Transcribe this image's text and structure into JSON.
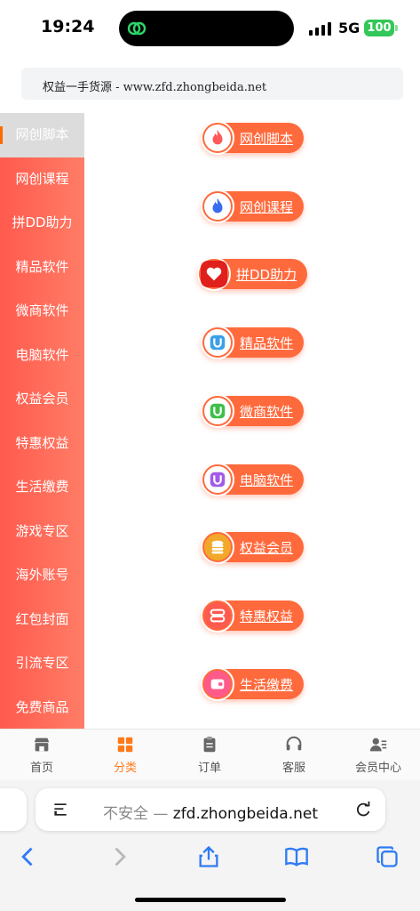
{
  "status": {
    "time": "19:24",
    "network": "5G",
    "battery": "100"
  },
  "notice": {
    "text": "权益一手货源 - www.zfd.zhongbeida.net"
  },
  "sidebar": {
    "items": [
      {
        "label": "网创脚本",
        "active": true
      },
      {
        "label": "网创课程"
      },
      {
        "label": "拼DD助力"
      },
      {
        "label": "精品软件"
      },
      {
        "label": "微商软件"
      },
      {
        "label": "电脑软件"
      },
      {
        "label": "权益会员"
      },
      {
        "label": "特惠权益"
      },
      {
        "label": "生活缴费"
      },
      {
        "label": "游戏专区"
      },
      {
        "label": "海外账号"
      },
      {
        "label": "红包封面"
      },
      {
        "label": "引流专区"
      },
      {
        "label": "免费商品"
      }
    ]
  },
  "categories": [
    {
      "label": "网创脚本",
      "icon": "flame-icon",
      "color": "#ff5a5a"
    },
    {
      "label": "网创课程",
      "icon": "flame-blue-icon",
      "color": "#3a6cf0"
    },
    {
      "label": "拼DD助力",
      "icon": "pdd-logo-icon",
      "color": "#e0201c"
    },
    {
      "label": "精品软件",
      "icon": "app-u-icon",
      "color": "#3aa0e8"
    },
    {
      "label": "微商软件",
      "icon": "app-u-green-icon",
      "color": "#3fbf4a"
    },
    {
      "label": "电脑软件",
      "icon": "app-u-purple-icon",
      "color": "#a35be6"
    },
    {
      "label": "权益会员",
      "icon": "coins-icon",
      "color": "#f2a82a"
    },
    {
      "label": "特惠权益",
      "icon": "stack-icon",
      "color": "#ff5a4e"
    },
    {
      "label": "生活缴费",
      "icon": "wallet-icon",
      "color": "#ff5a8a"
    }
  ],
  "tabbar": {
    "items": [
      {
        "label": "首页",
        "icon": "store-icon"
      },
      {
        "label": "分类",
        "icon": "grid-icon",
        "active": true
      },
      {
        "label": "订单",
        "icon": "clipboard-icon"
      },
      {
        "label": "客服",
        "icon": "headset-icon"
      },
      {
        "label": "会员中心",
        "icon": "user-card-icon"
      }
    ]
  },
  "browser": {
    "insecure_label": "不安全 —",
    "domain": "zfd.zhongbeida.net"
  }
}
